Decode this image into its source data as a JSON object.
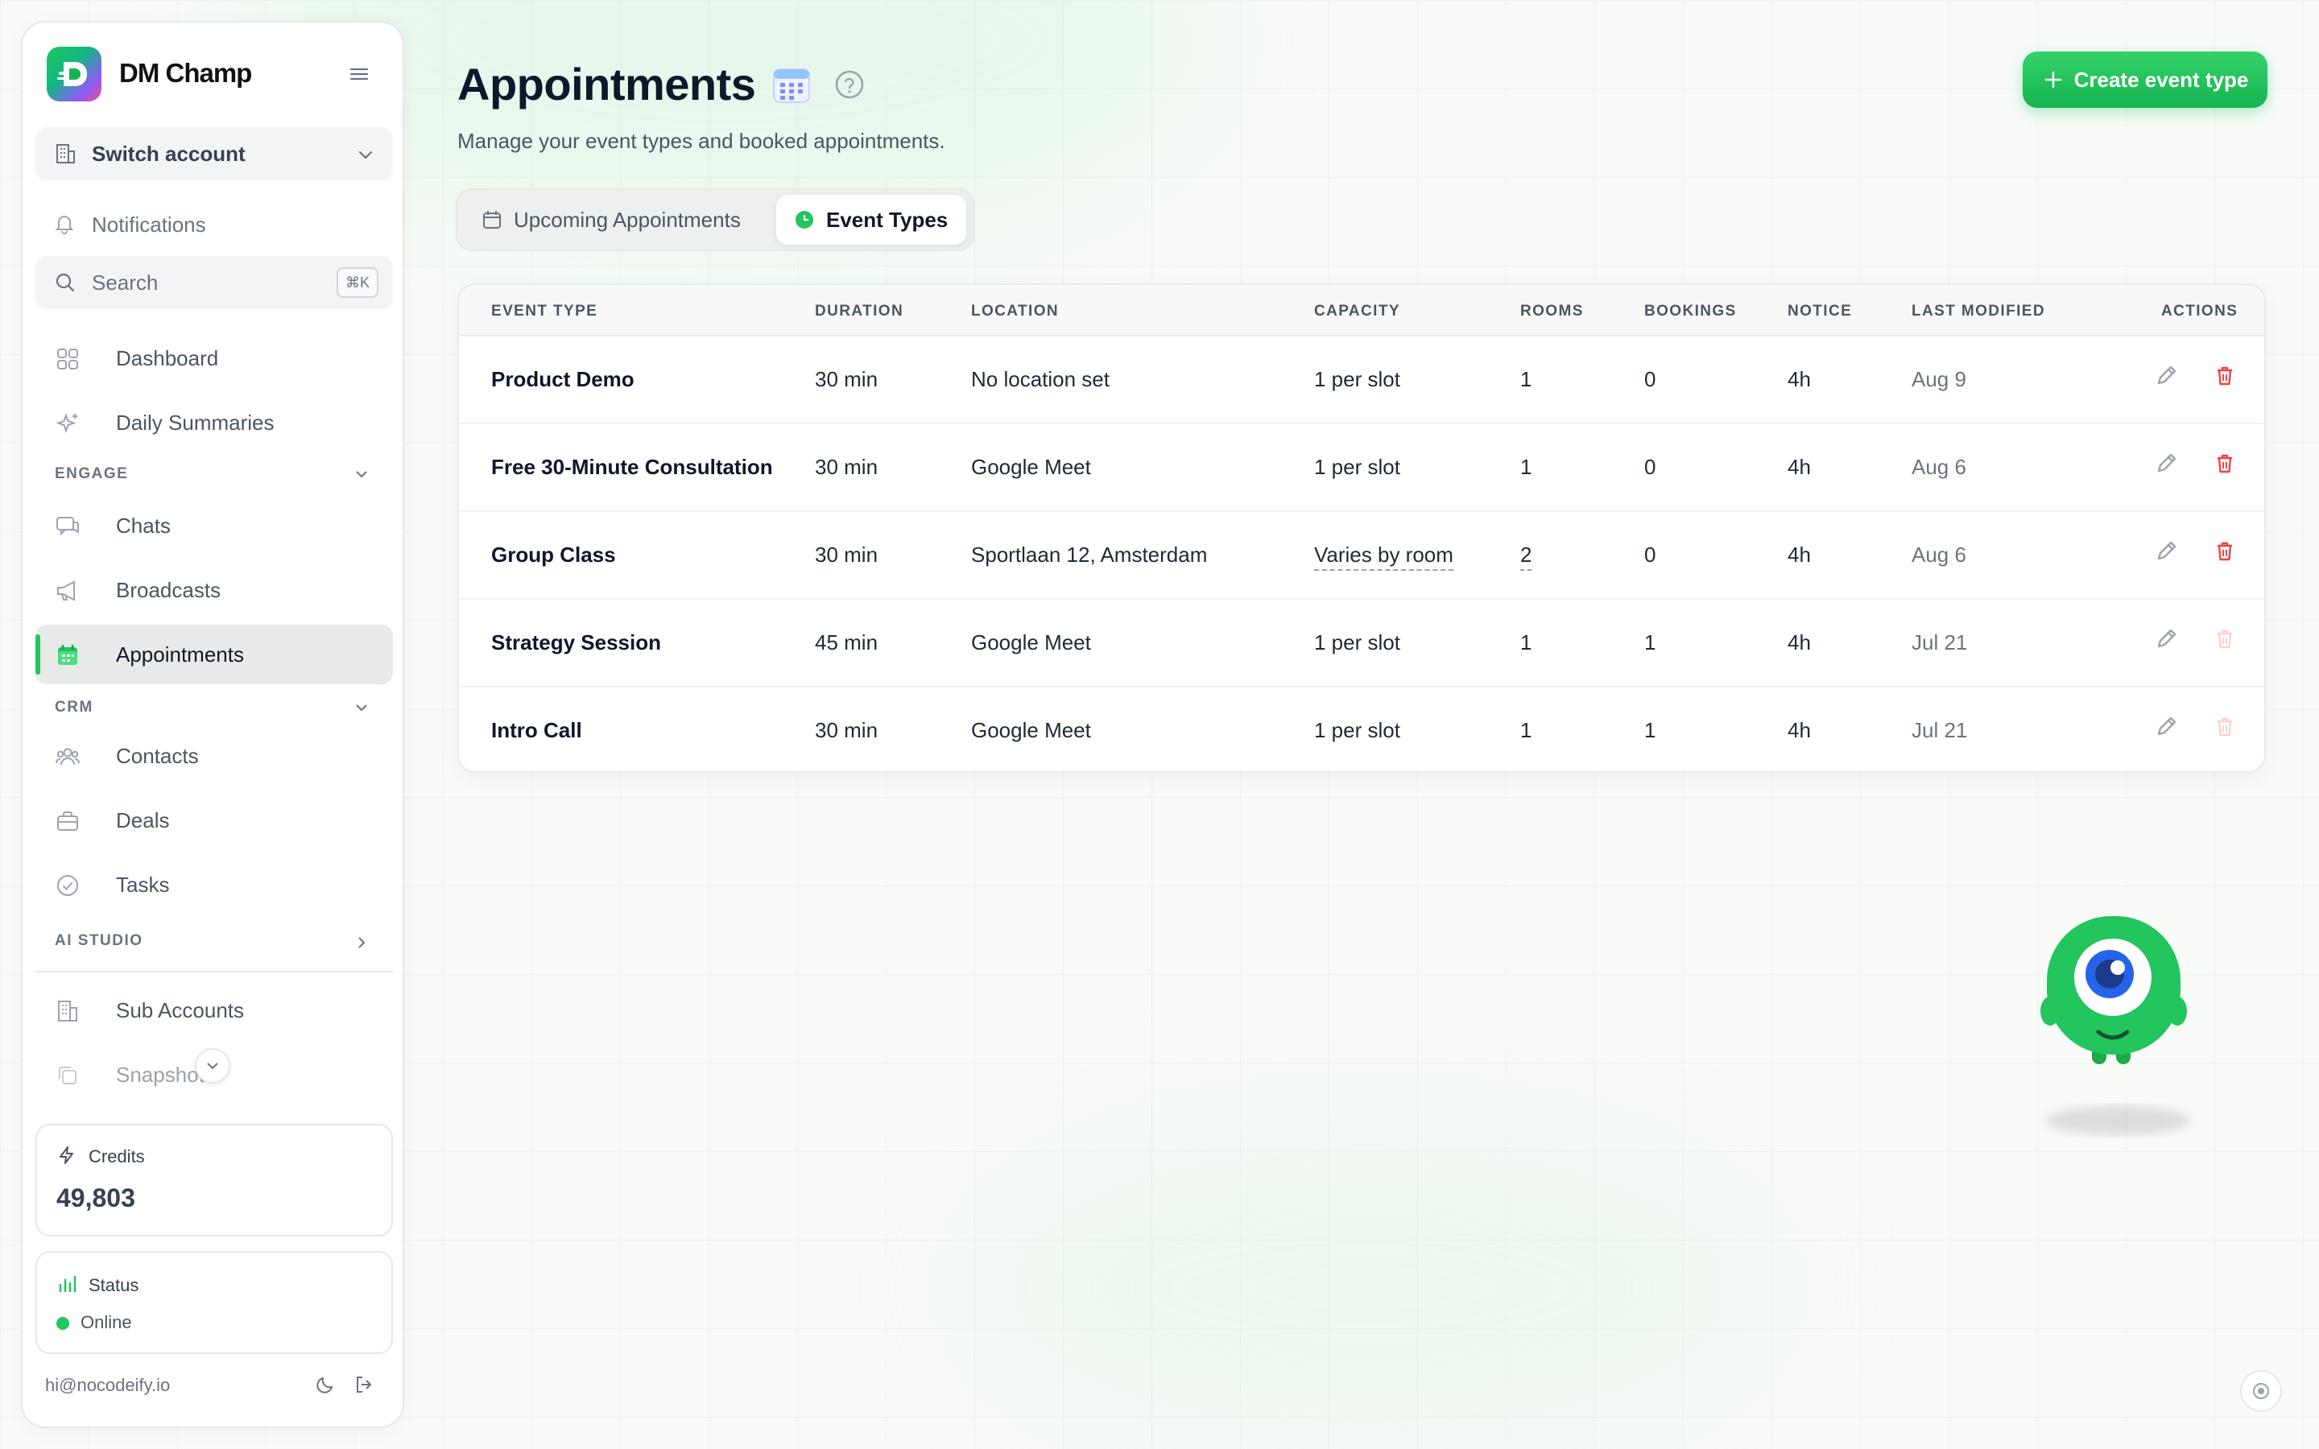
{
  "brand": {
    "name": "DM Champ"
  },
  "sidebar": {
    "switch_account": "Switch account",
    "notifications": "Notifications",
    "search_placeholder": "Search",
    "search_shortcut": "⌘K",
    "dashboard": "Dashboard",
    "daily_summaries": "Daily Summaries",
    "engage_section": "ENGAGE",
    "chats": "Chats",
    "broadcasts": "Broadcasts",
    "appointments": "Appointments",
    "crm_section": "CRM",
    "contacts": "Contacts",
    "deals": "Deals",
    "tasks": "Tasks",
    "ai_studio_section": "AI STUDIO",
    "sub_accounts": "Sub Accounts",
    "snapshots": "Snapshots",
    "credits_label": "Credits",
    "credits_value": "49,803",
    "status_label": "Status",
    "status_value": "Online",
    "user_email": "hi@nocodeify.io"
  },
  "page": {
    "title": "Appointments",
    "subtitle": "Manage your event types and booked appointments.",
    "create_button": "Create event type",
    "tabs": [
      {
        "label": "Upcoming Appointments",
        "active": false
      },
      {
        "label": "Event Types",
        "active": true
      }
    ]
  },
  "table": {
    "headers": [
      "EVENT TYPE",
      "DURATION",
      "LOCATION",
      "CAPACITY",
      "ROOMS",
      "BOOKINGS",
      "NOTICE",
      "LAST MODIFIED",
      "ACTIONS"
    ],
    "rows": [
      {
        "event_type": "Product Demo",
        "duration": "30 min",
        "location": "No location set",
        "capacity": "1 per slot",
        "rooms": "1",
        "bookings": "0",
        "notice": "4h",
        "last_modified": "Aug 9",
        "deletable": true
      },
      {
        "event_type": "Free 30-Minute Consultation",
        "duration": "30 min",
        "location": "Google Meet",
        "capacity": "1 per slot",
        "rooms": "1",
        "bookings": "0",
        "notice": "4h",
        "last_modified": "Aug 6",
        "deletable": true
      },
      {
        "event_type": "Group Class",
        "duration": "30 min",
        "location": "Sportlaan 12, Amsterdam",
        "capacity": "Varies by room",
        "rooms": "2",
        "bookings": "0",
        "notice": "4h",
        "last_modified": "Aug 6",
        "deletable": true
      },
      {
        "event_type": "Strategy Session",
        "duration": "45 min",
        "location": "Google Meet",
        "capacity": "1 per slot",
        "rooms": "1",
        "bookings": "1",
        "notice": "4h",
        "last_modified": "Jul 21",
        "deletable": false
      },
      {
        "event_type": "Intro Call",
        "duration": "30 min",
        "location": "Google Meet",
        "capacity": "1 per slot",
        "rooms": "1",
        "bookings": "1",
        "notice": "4h",
        "last_modified": "Jul 21",
        "deletable": false
      }
    ]
  },
  "colors": {
    "accent": "#22c55e",
    "active_nav_bg": "#e5e7eb",
    "delete_red": "#ef4444"
  },
  "icons": [
    "menu-icon",
    "building-icon",
    "bell-icon",
    "search-icon",
    "grid-icon",
    "sparkles-icon",
    "chat-icon",
    "megaphone-icon",
    "calendar-icon",
    "users-icon",
    "briefcase-icon",
    "check-circle-icon",
    "copy-icon",
    "bolt-icon",
    "bar-chart-icon",
    "moon-icon",
    "logout-icon",
    "help-icon",
    "plus-icon",
    "pencil-icon",
    "trash-icon",
    "mascot-icon"
  ]
}
